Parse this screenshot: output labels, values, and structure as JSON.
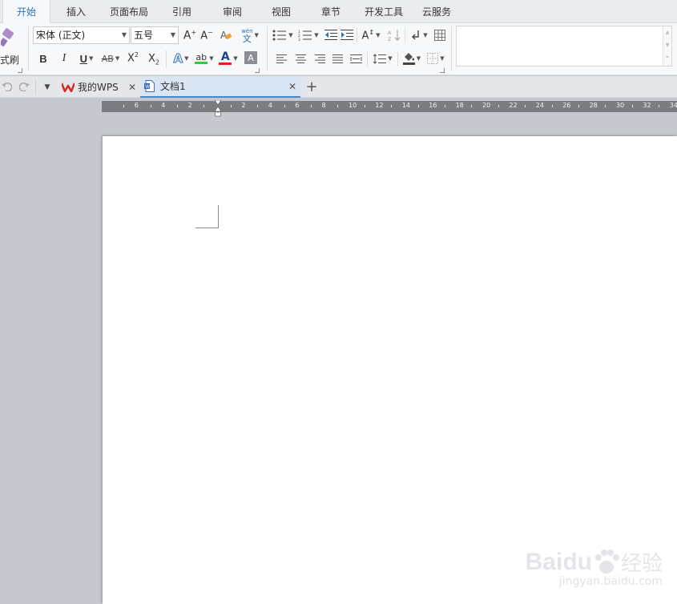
{
  "menu": {
    "tabs": [
      "开始",
      "插入",
      "页面布局",
      "引用",
      "审阅",
      "视图",
      "章节",
      "开发工具",
      "云服务"
    ],
    "active": 0
  },
  "ribbon": {
    "format_painter_label": "式刷",
    "font_name": "宋体 (正文)",
    "font_size": "五号",
    "bold": "B",
    "italic": "I",
    "underline": "U",
    "strikethrough": "AB",
    "superscript": "X",
    "subscript": "X",
    "grow_font": "A",
    "shrink_font": "A",
    "phonetic": "wén",
    "phonetic_char": "文",
    "font_color_letter": "A",
    "text_effect_letter": "A",
    "highlight_letter": "ab"
  },
  "tabbar": {
    "tabs": [
      {
        "label": "我的WPS"
      },
      {
        "label": "文档1"
      }
    ],
    "active": 1
  },
  "ruler": {
    "numbers": [
      "6",
      "4",
      "2",
      "2",
      "4",
      "6",
      "8",
      "10",
      "12",
      "14",
      "16",
      "18",
      "20",
      "22",
      "24",
      "26",
      "28",
      "30",
      "32",
      "34"
    ]
  },
  "watermark": {
    "brand": "Baidu",
    "cn": "经验",
    "url": "jingyan.baidu.com"
  },
  "colors": {
    "accent": "#2b6fb5",
    "wps_red": "#d7251f",
    "highlight_green": "#33cc33",
    "font_red": "#e02020",
    "page_bg": "#c5c8ce"
  }
}
